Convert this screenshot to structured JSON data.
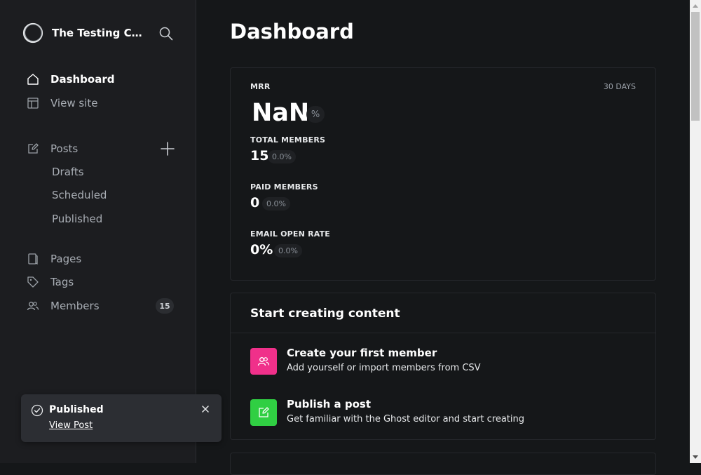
{
  "site": {
    "title": "The Testing Company"
  },
  "nav": {
    "dashboard": "Dashboard",
    "view_site": "View site",
    "posts": "Posts",
    "drafts": "Drafts",
    "scheduled": "Scheduled",
    "published": "Published",
    "pages": "Pages",
    "tags": "Tags",
    "members": "Members",
    "members_count": "15"
  },
  "toast": {
    "title": "Published",
    "link": "View Post"
  },
  "main": {
    "title": "Dashboard",
    "stats": {
      "mrr_label": "MRR",
      "range": "30 DAYS",
      "mrr_value": "NaN",
      "mrr_unit": "%",
      "total_label": "TOTAL MEMBERS",
      "total_value": "15",
      "total_change": "0.0%",
      "paid_label": "PAID MEMBERS",
      "paid_value": "0",
      "paid_change": "0.0%",
      "open_label": "EMAIL OPEN RATE",
      "open_value": "0%",
      "open_change": "0.0%"
    },
    "start": {
      "heading": "Start creating content",
      "member_title": "Create your first member",
      "member_sub": "Add yourself or import members from CSV",
      "post_title": "Publish a post",
      "post_sub": "Get familiar with the Ghost editor and start creating"
    }
  },
  "colors": {
    "member_tile": "#f0308a",
    "post_tile": "#30cf43",
    "background": "#151719",
    "sidebar": "#1c1d20"
  },
  "icons": [
    "logo-icon",
    "search-icon",
    "home-icon",
    "layout-icon",
    "edit-icon",
    "plus-icon",
    "page-icon",
    "tag-icon",
    "members-icon",
    "check-circle-icon",
    "close-icon",
    "users-icon",
    "pencil-square-icon"
  ]
}
